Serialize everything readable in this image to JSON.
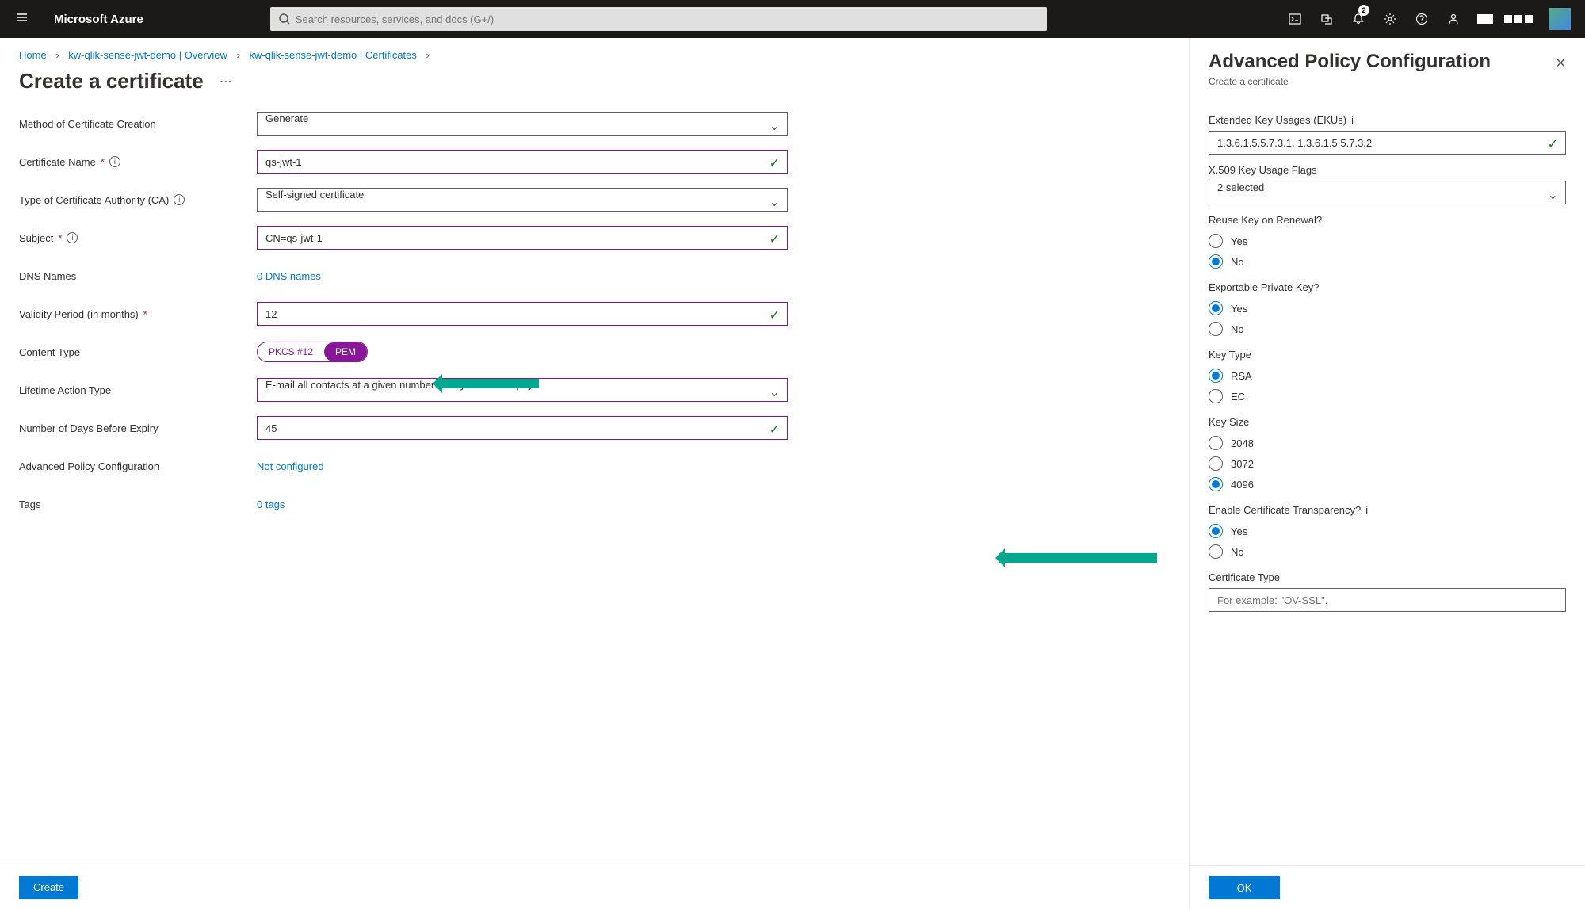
{
  "topbar": {
    "brand": "Microsoft Azure",
    "search_placeholder": "Search resources, services, and docs (G+/)",
    "notification_badge": "2"
  },
  "breadcrumb": {
    "items": [
      "Home",
      "kw-qlik-sense-jwt-demo | Overview",
      "kw-qlik-sense-jwt-demo | Certificates"
    ]
  },
  "page": {
    "title": "Create a certificate"
  },
  "form": {
    "method_label": "Method of Certificate Creation",
    "method_value": "Generate",
    "name_label": "Certificate Name",
    "name_value": "qs-jwt-1",
    "ca_label": "Type of Certificate Authority (CA)",
    "ca_value": "Self-signed certificate",
    "subject_label": "Subject",
    "subject_value": "CN=qs-jwt-1",
    "dns_label": "DNS Names",
    "dns_link": "0 DNS names",
    "validity_label": "Validity Period (in months)",
    "validity_value": "12",
    "content_label": "Content Type",
    "content_opt1": "PKCS #12",
    "content_opt2": "PEM",
    "lifetime_label": "Lifetime Action Type",
    "lifetime_value": "E-mail all contacts at a given number of days before expiry",
    "days_label": "Number of Days Before Expiry",
    "days_value": "45",
    "adv_label": "Advanced Policy Configuration",
    "adv_link": "Not configured",
    "tags_label": "Tags",
    "tags_link": "0 tags"
  },
  "buttons": {
    "create": "Create",
    "ok": "OK"
  },
  "panel": {
    "title": "Advanced Policy Configuration",
    "subtitle": "Create a certificate",
    "eku_label": "Extended Key Usages (EKUs)",
    "eku_value": "1.3.6.1.5.5.7.3.1, 1.3.6.1.5.5.7.3.2",
    "x509_label": "X.509 Key Usage Flags",
    "x509_value": "2 selected",
    "reuse_label": "Reuse Key on Renewal?",
    "reuse_opts": [
      "Yes",
      "No"
    ],
    "reuse_selected": "No",
    "export_label": "Exportable Private Key?",
    "export_opts": [
      "Yes",
      "No"
    ],
    "export_selected": "Yes",
    "keytype_label": "Key Type",
    "keytype_opts": [
      "RSA",
      "EC"
    ],
    "keytype_selected": "RSA",
    "keysize_label": "Key Size",
    "keysize_opts": [
      "2048",
      "3072",
      "4096"
    ],
    "keysize_selected": "4096",
    "transparency_label": "Enable Certificate Transparency?",
    "transparency_opts": [
      "Yes",
      "No"
    ],
    "transparency_selected": "Yes",
    "certtype_label": "Certificate Type",
    "certtype_placeholder": "For example: \"OV-SSL\"."
  }
}
